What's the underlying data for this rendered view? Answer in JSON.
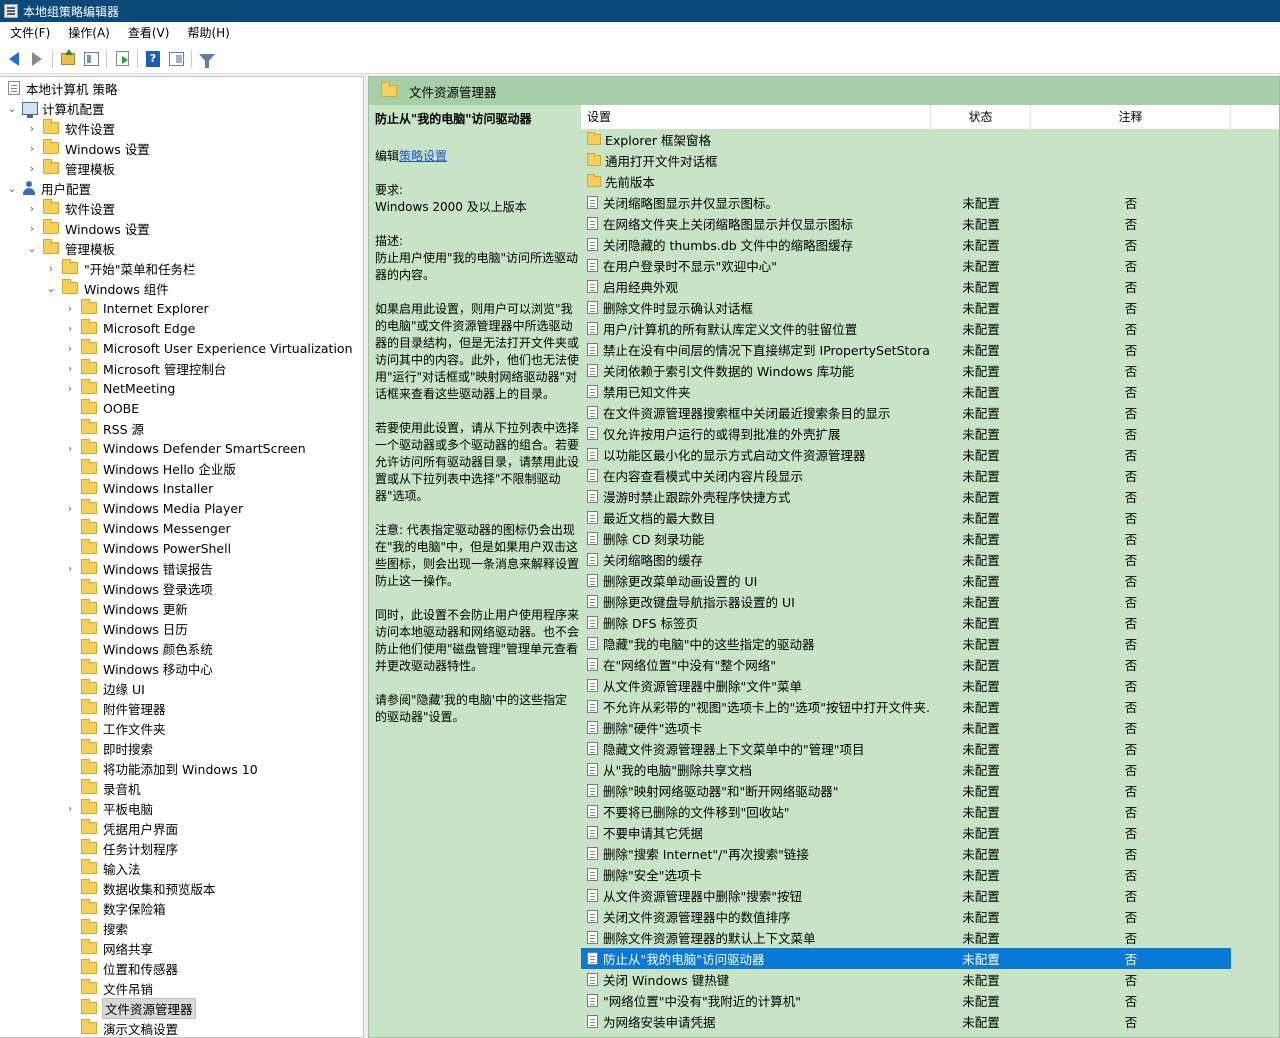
{
  "window": {
    "title": "本地组策略编辑器"
  },
  "menu": [
    "文件(F)",
    "操作(A)",
    "查看(V)",
    "帮助(H)"
  ],
  "toolbar": [
    "back-icon",
    "forward-icon",
    "up-folder-icon",
    "show-tree-icon",
    "export-icon",
    "help-icon",
    "properties-icon",
    "filter-icon"
  ],
  "tree": {
    "root": "本地计算机 策略",
    "computer_config": "计算机配置",
    "cc_software": "软件设置",
    "cc_windows": "Windows 设置",
    "cc_admin": "管理模板",
    "user_config": "用户配置",
    "uc_software": "软件设置",
    "uc_windows": "Windows 设置",
    "uc_admin": "管理模板",
    "start_menu": "\"开始\"菜单和任务栏",
    "win_components": "Windows 组件",
    "components": [
      "Internet Explorer",
      "Microsoft Edge",
      "Microsoft User Experience Virtualization",
      "Microsoft 管理控制台",
      "NetMeeting",
      "OOBE",
      "RSS 源",
      "Windows Defender SmartScreen",
      "Windows Hello 企业版",
      "Windows Installer",
      "Windows Media Player",
      "Windows Messenger",
      "Windows PowerShell",
      "Windows 错误报告",
      "Windows 登录选项",
      "Windows 更新",
      "Windows 日历",
      "Windows 颜色系统",
      "Windows 移动中心",
      "边缘 UI",
      "附件管理器",
      "工作文件夹",
      "即时搜索",
      "将功能添加到 Windows 10",
      "录音机",
      "平板电脑",
      "凭据用户界面",
      "任务计划程序",
      "输入法",
      "数据收集和预览版本",
      "数字保险箱",
      "搜索",
      "网络共享",
      "位置和传感器",
      "文件吊销",
      "文件资源管理器",
      "演示文稿设置"
    ]
  },
  "panel": {
    "title": "文件资源管理器"
  },
  "description": {
    "title": "防止从\"我的电脑\"访问驱动器",
    "edit_prefix": "编辑",
    "edit_link": "策略设置",
    "requirements_label": "要求:",
    "requirements_value": "Windows 2000 及以上版本",
    "desc_label": "描述:",
    "desc_text": "防止用户使用\"我的电脑\"访问所选驱动器的内容。",
    "para1": "如果启用此设置，则用户可以浏览\"我的电脑\"或文件资源管理器中所选驱动器的目录结构，但是无法打开文件夹或访问其中的内容。此外，他们也无法使用\"运行\"对话框或\"映射网络驱动器\"对话框来查看这些驱动器上的目录。",
    "para2": "若要使用此设置，请从下拉列表中选择一个驱动器或多个驱动器的组合。若要允许访问所有驱动器目录，请禁用此设置或从下拉列表中选择\"不限制驱动器\"选项。",
    "para3": "注意: 代表指定驱动器的图标仍会出现在\"我的电脑\"中，但是如果用户双击这些图标，则会出现一条消息来解释设置防止这一操作。",
    "para4": " 同时，此设置不会防止用户使用程序来访问本地驱动器和网络驱动器。也不会防止他们使用\"磁盘管理\"管理单元查看并更改驱动器特性。",
    "para5": "请参阅\"隐藏'我的电脑'中的这些指定的驱动器\"设置。"
  },
  "columns": {
    "setting": "设置",
    "state": "状态",
    "comment": "注释"
  },
  "folders": [
    "Explorer 框架窗格",
    "通用打开文件对话框",
    "先前版本"
  ],
  "settings": [
    {
      "name": "关闭缩略图显示并仅显示图标。",
      "state": "未配置",
      "comment": "否"
    },
    {
      "name": "在网络文件夹上关闭缩略图显示并仅显示图标",
      "state": "未配置",
      "comment": "否"
    },
    {
      "name": "关闭隐藏的 thumbs.db 文件中的缩略图缓存",
      "state": "未配置",
      "comment": "否"
    },
    {
      "name": "在用户登录时不显示\"欢迎中心\"",
      "state": "未配置",
      "comment": "否"
    },
    {
      "name": "启用经典外观",
      "state": "未配置",
      "comment": "否"
    },
    {
      "name": "删除文件时显示确认对话框",
      "state": "未配置",
      "comment": "否"
    },
    {
      "name": "用户/计算机的所有默认库定义文件的驻留位置",
      "state": "未配置",
      "comment": "否"
    },
    {
      "name": "禁止在没有中间层的情况下直接绑定到 IPropertySetStora...",
      "state": "未配置",
      "comment": "否"
    },
    {
      "name": "关闭依赖于索引文件数据的 Windows 库功能",
      "state": "未配置",
      "comment": "否"
    },
    {
      "name": "禁用已知文件夹",
      "state": "未配置",
      "comment": "否"
    },
    {
      "name": "在文件资源管理器搜索框中关闭最近搜索条目的显示",
      "state": "未配置",
      "comment": "否"
    },
    {
      "name": "仅允许按用户运行的或得到批准的外壳扩展",
      "state": "未配置",
      "comment": "否"
    },
    {
      "name": "以功能区最小化的显示方式启动文件资源管理器",
      "state": "未配置",
      "comment": "否"
    },
    {
      "name": "在内容查看模式中关闭内容片段显示",
      "state": "未配置",
      "comment": "否"
    },
    {
      "name": "漫游时禁止跟踪外壳程序快捷方式",
      "state": "未配置",
      "comment": "否"
    },
    {
      "name": "最近文档的最大数目",
      "state": "未配置",
      "comment": "否"
    },
    {
      "name": "删除 CD 刻录功能",
      "state": "未配置",
      "comment": "否"
    },
    {
      "name": "关闭缩略图的缓存",
      "state": "未配置",
      "comment": "否"
    },
    {
      "name": "删除更改菜单动画设置的 UI",
      "state": "未配置",
      "comment": "否"
    },
    {
      "name": "删除更改键盘导航指示器设置的 UI",
      "state": "未配置",
      "comment": "否"
    },
    {
      "name": "删除 DFS 标签页",
      "state": "未配置",
      "comment": "否"
    },
    {
      "name": "隐藏\"我的电脑\"中的这些指定的驱动器",
      "state": "未配置",
      "comment": "否"
    },
    {
      "name": "在\"网络位置\"中没有\"整个网络\"",
      "state": "未配置",
      "comment": "否"
    },
    {
      "name": "从文件资源管理器中删除\"文件\"菜单",
      "state": "未配置",
      "comment": "否"
    },
    {
      "name": "不允许从彩带的\"视图\"选项卡上的\"选项\"按钮中打开文件夹...",
      "state": "未配置",
      "comment": "否"
    },
    {
      "name": "删除\"硬件\"选项卡",
      "state": "未配置",
      "comment": "否"
    },
    {
      "name": "隐藏文件资源管理器上下文菜单中的\"管理\"项目",
      "state": "未配置",
      "comment": "否"
    },
    {
      "name": "从\"我的电脑\"删除共享文档",
      "state": "未配置",
      "comment": "否"
    },
    {
      "name": "删除\"映射网络驱动器\"和\"断开网络驱动器\"",
      "state": "未配置",
      "comment": "否"
    },
    {
      "name": "不要将已删除的文件移到\"回收站\"",
      "state": "未配置",
      "comment": "否"
    },
    {
      "name": "不要申请其它凭据",
      "state": "未配置",
      "comment": "否"
    },
    {
      "name": "删除\"搜索 Internet\"/\"再次搜索\"链接",
      "state": "未配置",
      "comment": "否"
    },
    {
      "name": "删除\"安全\"选项卡",
      "state": "未配置",
      "comment": "否"
    },
    {
      "name": "从文件资源管理器中删除\"搜索\"按钮",
      "state": "未配置",
      "comment": "否"
    },
    {
      "name": "关闭文件资源管理器中的数值排序",
      "state": "未配置",
      "comment": "否"
    },
    {
      "name": "删除文件资源管理器的默认上下文菜单",
      "state": "未配置",
      "comment": "否"
    },
    {
      "name": "防止从\"我的电脑\"访问驱动器",
      "state": "未配置",
      "comment": "否"
    },
    {
      "name": "关闭 Windows 键热键",
      "state": "未配置",
      "comment": "否"
    },
    {
      "name": "\"网络位置\"中没有\"我附近的计算机\"",
      "state": "未配置",
      "comment": "否"
    },
    {
      "name": "为网络安装申请凭据",
      "state": "未配置",
      "comment": "否"
    }
  ],
  "selected_setting_index": 36
}
